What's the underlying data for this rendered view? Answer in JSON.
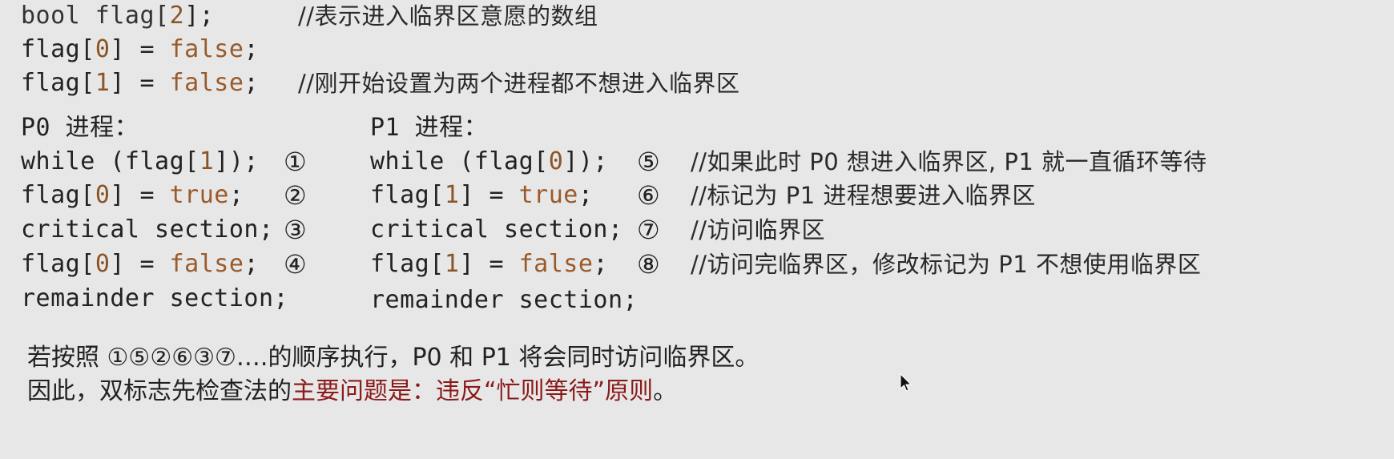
{
  "header": {
    "decl_1": {
      "code": "bool flag[",
      "num": "2",
      "end": "];",
      "comment": "//表示进入临界区意愿的数组"
    },
    "decl_2": {
      "code": "flag[",
      "num": "0",
      "mid": "] = ",
      "bool": "false",
      "end": ";"
    },
    "decl_3": {
      "code": "flag[",
      "num": "1",
      "mid": "] = ",
      "bool": "false",
      "end": ";",
      "comment": "//刚开始设置为两个进程都不想进入临界区"
    }
  },
  "p0": {
    "title": "P0 进程：",
    "lines": [
      {
        "pre": "while (flag[",
        "num": "1",
        "post": "]);",
        "step": "①"
      },
      {
        "pre": "flag[",
        "num": "0",
        "mid": "] = ",
        "bool": "true",
        "post": ";",
        "step": "②"
      },
      {
        "pre": "critical section;",
        "step": "③"
      },
      {
        "pre": "flag[",
        "num": "0",
        "mid": "] = ",
        "bool": "false",
        "post": ";",
        "step": "④"
      },
      {
        "pre": "remainder section;"
      }
    ]
  },
  "p1": {
    "title": "P1 进程：",
    "lines": [
      {
        "pre": "while (flag[",
        "num": "0",
        "post": "]);",
        "step": "⑤",
        "comment": "//如果此时 P0 想进入临界区, P1 就一直循环等待"
      },
      {
        "pre": "flag[",
        "num": "1",
        "mid": "] = ",
        "bool": "true",
        "post": ";",
        "step": "⑥",
        "comment": "//标记为 P1 进程想要进入临界区"
      },
      {
        "pre": "critical section;",
        "step": "⑦",
        "comment": "//访问临界区"
      },
      {
        "pre": "flag[",
        "num": "1",
        "mid": "] = ",
        "bool": "false",
        "post": ";",
        "step": "⑧",
        "comment": "//访问完临界区，修改标记为 P1 不想使用临界区"
      },
      {
        "pre": "remainder section;"
      }
    ]
  },
  "summary": {
    "line1": "若按照 ①⑤②⑥③⑦….的顺序执行，P0 和 P1 将会同时访问临界区。",
    "line2_a": "因此，双标志先检查法的",
    "line2_b": "主要问题是：违反“忙则等待”原则",
    "line2_c": "。"
  },
  "colors": {
    "background": "#e7e7e7",
    "literal": "#8a5526",
    "emphasis": "#8b1a1a"
  }
}
